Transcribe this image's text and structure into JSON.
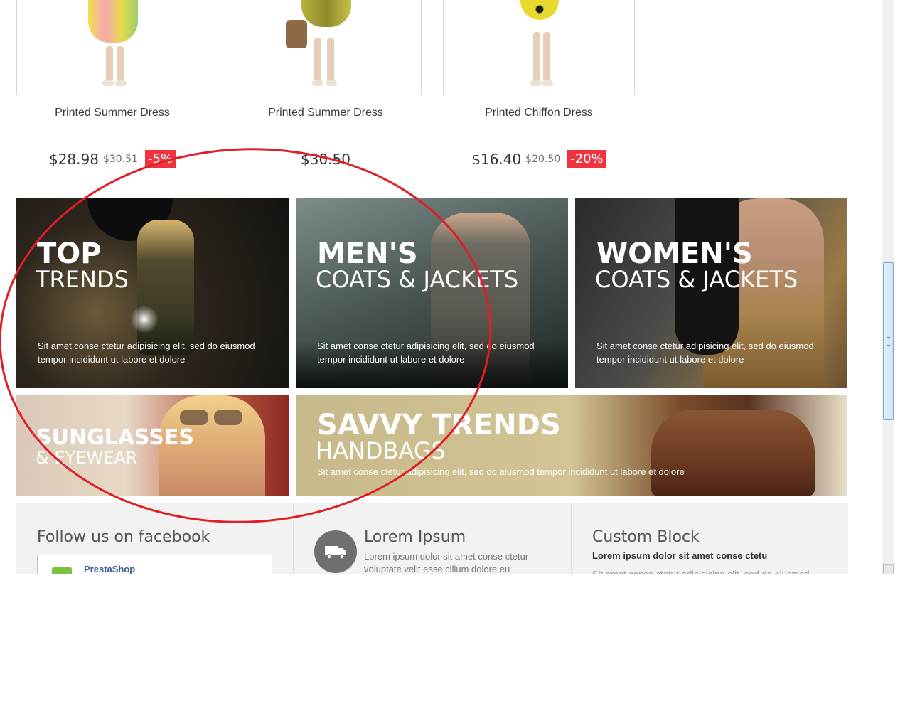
{
  "products": [
    {
      "name": "Printed Summer Dress",
      "price": "$28.98",
      "old_price": "$30.51",
      "discount": "-5%",
      "dress_color": "#f3e04b"
    },
    {
      "name": "Printed Summer Dress",
      "price": "$30.50",
      "old_price": "",
      "discount": "",
      "dress_color": "#a9a53a"
    },
    {
      "name": "Printed Chiffon Dress",
      "price": "$16.40",
      "old_price": "$20.50",
      "discount": "-20%",
      "dress_color": "#e8d930"
    }
  ],
  "banners": {
    "top_trends": {
      "line1": "TOP",
      "line2": "TRENDS",
      "desc1": "Sit amet conse ctetur adipisicing elit, sed do eiusmod",
      "desc2": "tempor incididunt ut labore et dolore"
    },
    "mens": {
      "line1": "MEN'S",
      "line2": "COATS & JACKETS",
      "desc1": "Sit amet conse ctetur adipisicing elit, sed do eiusmod",
      "desc2": "tempor incididunt ut labore et dolore"
    },
    "womens": {
      "line1": "WOMEN'S",
      "line2": "COATS & JACKETS",
      "desc1": "Sit amet conse ctetur adipisicing elit, sed do eiusmod",
      "desc2": "tempor incididunt ut labore et dolore"
    },
    "sunglasses": {
      "line1": "SUNGLASSES",
      "line2": "& EYEWEAR"
    },
    "handbags": {
      "line1": "SAVVY TRENDS",
      "line2": "HANDBAGS",
      "desc": "Sit amet conse ctetur adipisicing elit, sed do eiusmod tempor incididunt ut labore et dolore"
    }
  },
  "footer": {
    "facebook_title": "Follow us on facebook",
    "facebook_page": "PrestaShop",
    "lorem_title": "Lorem Ipsum",
    "lorem_text": "Lorem ipsum dolor sit amet conse ctetur voluptate velit esse cillum dolore eu",
    "custom_title": "Custom Block",
    "custom_bold": "Lorem ipsum dolor sit amet conse ctetu",
    "custom_line": "Sit amet conse ctetur adipisicing elit, sed do eiusmod"
  },
  "colors": {
    "discount_bg": "#f13340",
    "annotation_circle": "#e01e25",
    "footer_bg": "#f2f2f2"
  },
  "icons": [
    "truck-icon",
    "shopping-bag-logo-icon"
  ]
}
